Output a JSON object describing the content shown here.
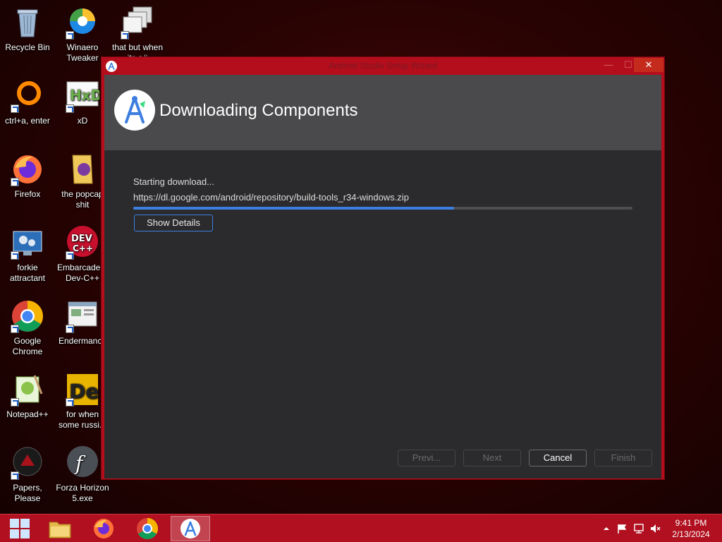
{
  "desktop": {
    "icons": [
      {
        "label": "Recycle Bin"
      },
      {
        "label": "Winaero Tweaker"
      },
      {
        "label": "that but when its a#"
      },
      {
        "label": "ctrl+a, enter"
      },
      {
        "label": "xD"
      },
      {
        "label": "Firefox"
      },
      {
        "label": "the popcap shit"
      },
      {
        "label": "forkie attractant"
      },
      {
        "label": "Embarcadero Dev-C++"
      },
      {
        "label": "Google Chrome"
      },
      {
        "label": "Endermanch"
      },
      {
        "label": "Notepad++"
      },
      {
        "label": "for when some russi..."
      },
      {
        "label": "Papers, Please"
      },
      {
        "label": "Forza Horizon 5.exe"
      }
    ]
  },
  "window": {
    "title": "Android Studio Setup Wizard",
    "header_title": "Downloading Components",
    "status": "Starting download...",
    "url": "https://dl.google.com/android/repository/build-tools_r34-windows.zip",
    "progress": 0.643,
    "show_details": "Show Details",
    "buttons": {
      "prev": "Previ...",
      "next": "Next",
      "cancel": "Cancel",
      "finish": "Finish"
    },
    "controls": {
      "minimize": "—",
      "maximize": "☐",
      "close": "✕"
    }
  },
  "taskbar": {
    "items": [
      "start-icon",
      "file-explorer-icon",
      "firefox-icon",
      "chrome-icon",
      "android-studio-icon"
    ],
    "clock_time": "9:41 PM",
    "clock_date": "2/13/2024"
  },
  "colors": {
    "accent": "#3d7fe0",
    "taskbar": "#b0101f",
    "window_border": "#b40d1c"
  }
}
